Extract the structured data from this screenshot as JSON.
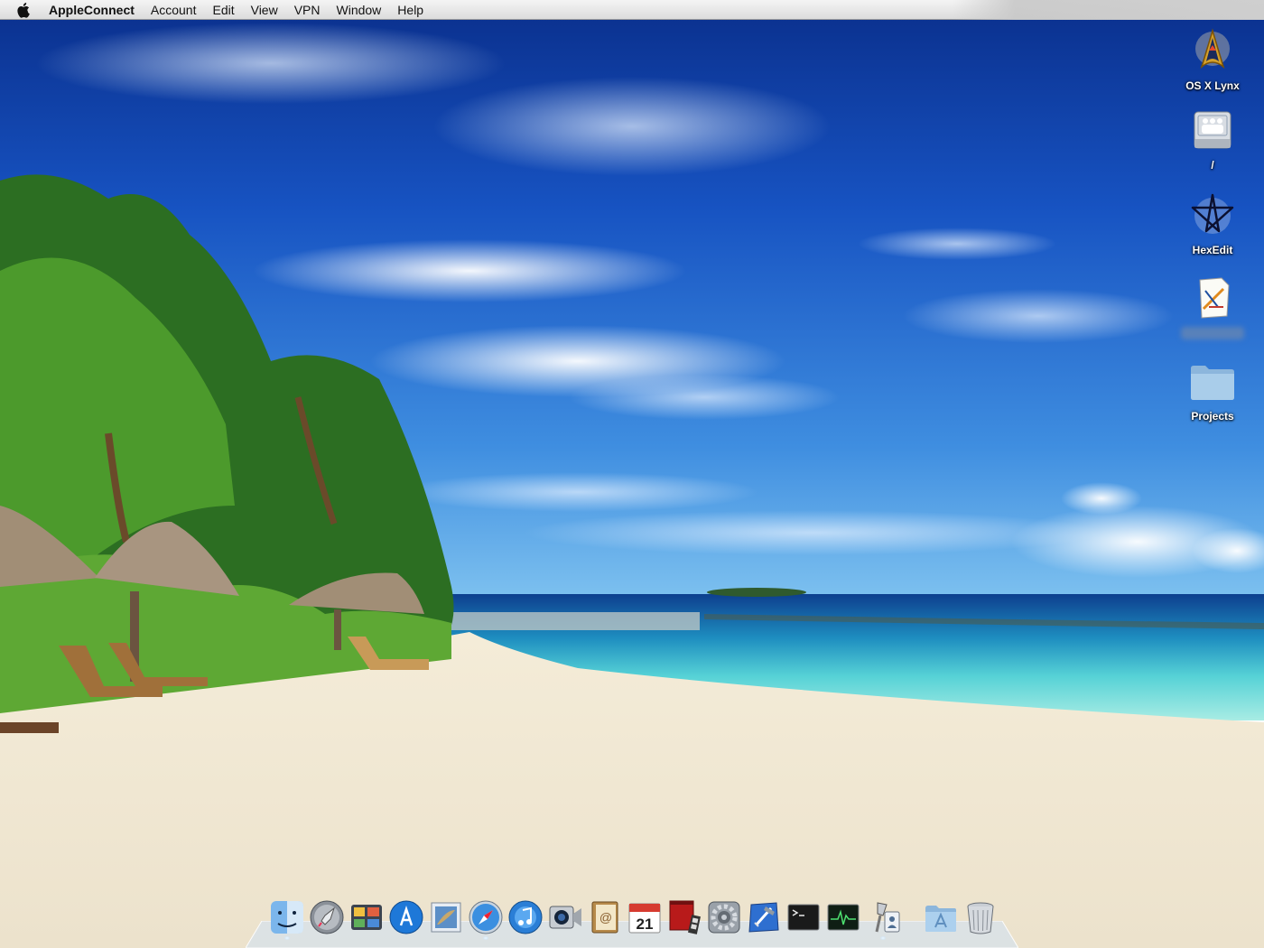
{
  "menubar": {
    "apple_icon": "apple-logo-icon",
    "app_name": "AppleConnect",
    "items": [
      "Account",
      "Edit",
      "View",
      "VPN",
      "Window",
      "Help"
    ]
  },
  "desktop_icons": [
    {
      "label": "OS X Lynx",
      "icon": "starfleet-insignia-icon"
    },
    {
      "label": "/",
      "icon": "network-drive-icon"
    },
    {
      "label": "HexEdit",
      "icon": "pentagram-icon"
    },
    {
      "label": "",
      "icon": "app-document-icon"
    },
    {
      "label": "Projects",
      "icon": "folder-icon"
    }
  ],
  "dock": {
    "apps": [
      {
        "name": "Finder",
        "icon": "finder-icon",
        "running": true
      },
      {
        "name": "Launchpad",
        "icon": "launchpad-icon",
        "running": false
      },
      {
        "name": "Dashboard",
        "icon": "dashboard-icon",
        "running": false
      },
      {
        "name": "App Store",
        "icon": "app-store-icon",
        "running": false
      },
      {
        "name": "Mail",
        "icon": "mail-icon",
        "running": false
      },
      {
        "name": "Safari",
        "icon": "safari-icon",
        "running": true
      },
      {
        "name": "iTunes",
        "icon": "itunes-icon",
        "running": false
      },
      {
        "name": "FaceTime",
        "icon": "facetime-icon",
        "running": false
      },
      {
        "name": "Address Book",
        "icon": "address-book-icon",
        "running": false
      },
      {
        "name": "iCal",
        "icon": "calendar-icon",
        "running": false,
        "date": "21"
      },
      {
        "name": "Photo Booth",
        "icon": "photo-booth-icon",
        "running": false
      },
      {
        "name": "System Preferences",
        "icon": "system-preferences-icon",
        "running": false
      },
      {
        "name": "Xcode",
        "icon": "xcode-icon",
        "running": false
      },
      {
        "name": "Terminal",
        "icon": "terminal-icon",
        "running": false
      },
      {
        "name": "Activity Monitor",
        "icon": "activity-monitor-icon",
        "running": false
      },
      {
        "name": "Directory Utility",
        "icon": "directory-utility-icon",
        "running": true
      },
      {
        "name": "Applications",
        "icon": "applications-folder-icon",
        "running": false
      },
      {
        "name": "Trash",
        "icon": "trash-icon",
        "running": false
      }
    ]
  }
}
